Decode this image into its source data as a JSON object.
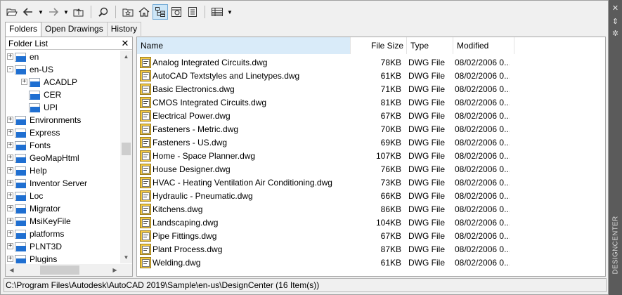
{
  "toolbar": {
    "buttons": [
      {
        "icon": "open-folder-icon",
        "active": false
      },
      {
        "icon": "back-arrow-icon",
        "active": false,
        "dropdown": true
      },
      {
        "icon": "forward-arrow-icon",
        "active": false,
        "dropdown": true
      },
      {
        "icon": "up-folder-icon",
        "active": false
      },
      {
        "icon": "search-icon",
        "active": false
      },
      {
        "icon": "favorites-icon",
        "active": false
      },
      {
        "icon": "home-icon",
        "active": false
      },
      {
        "icon": "tree-view-toggle-icon",
        "active": true
      },
      {
        "icon": "preview-icon",
        "active": false
      },
      {
        "icon": "description-icon",
        "active": false
      },
      {
        "icon": "views-icon",
        "active": false,
        "dropdown": true
      }
    ]
  },
  "tabs": [
    {
      "label": "Folders",
      "active": true
    },
    {
      "label": "Open Drawings",
      "active": false
    },
    {
      "label": "History",
      "active": false
    }
  ],
  "folder_list": {
    "header": "Folder List",
    "close_glyph": "✕",
    "items": [
      {
        "label": "en",
        "depth": 0,
        "expander": "+"
      },
      {
        "label": "en-US",
        "depth": 0,
        "expander": "−"
      },
      {
        "label": "ACADLP",
        "depth": 1,
        "expander": "+"
      },
      {
        "label": "CER",
        "depth": 1,
        "expander": ""
      },
      {
        "label": "UPI",
        "depth": 1,
        "expander": ""
      },
      {
        "label": "Environments",
        "depth": 0,
        "expander": "+"
      },
      {
        "label": "Express",
        "depth": 0,
        "expander": "+"
      },
      {
        "label": "Fonts",
        "depth": 0,
        "expander": "+"
      },
      {
        "label": "GeoMapHtml",
        "depth": 0,
        "expander": "+"
      },
      {
        "label": "Help",
        "depth": 0,
        "expander": "+"
      },
      {
        "label": "Inventor Server",
        "depth": 0,
        "expander": "+"
      },
      {
        "label": "Loc",
        "depth": 0,
        "expander": "+"
      },
      {
        "label": "Migrator",
        "depth": 0,
        "expander": "+"
      },
      {
        "label": "MsiKeyFile",
        "depth": 0,
        "expander": "+"
      },
      {
        "label": "platforms",
        "depth": 0,
        "expander": "+"
      },
      {
        "label": "PLNT3D",
        "depth": 0,
        "expander": "+"
      },
      {
        "label": "Plugins",
        "depth": 0,
        "expander": "+"
      }
    ]
  },
  "file_list": {
    "columns": {
      "name": "Name",
      "size": "File Size",
      "type": "Type",
      "modified": "Modified"
    },
    "rows": [
      {
        "name": "Analog Integrated Circuits.dwg",
        "size": "78KB",
        "type": "DWG File",
        "modified": "08/02/2006 0..."
      },
      {
        "name": "AutoCAD Textstyles and Linetypes.dwg",
        "size": "61KB",
        "type": "DWG File",
        "modified": "08/02/2006 0..."
      },
      {
        "name": "Basic Electronics.dwg",
        "size": "71KB",
        "type": "DWG File",
        "modified": "08/02/2006 0..."
      },
      {
        "name": "CMOS Integrated Circuits.dwg",
        "size": "81KB",
        "type": "DWG File",
        "modified": "08/02/2006 0..."
      },
      {
        "name": "Electrical Power.dwg",
        "size": "67KB",
        "type": "DWG File",
        "modified": "08/02/2006 0..."
      },
      {
        "name": "Fasteners - Metric.dwg",
        "size": "70KB",
        "type": "DWG File",
        "modified": "08/02/2006 0..."
      },
      {
        "name": "Fasteners - US.dwg",
        "size": "69KB",
        "type": "DWG File",
        "modified": "08/02/2006 0..."
      },
      {
        "name": "Home - Space Planner.dwg",
        "size": "107KB",
        "type": "DWG File",
        "modified": "08/02/2006 0..."
      },
      {
        "name": "House Designer.dwg",
        "size": "76KB",
        "type": "DWG File",
        "modified": "08/02/2006 0..."
      },
      {
        "name": "HVAC - Heating Ventilation Air Conditioning.dwg",
        "size": "73KB",
        "type": "DWG File",
        "modified": "08/02/2006 0..."
      },
      {
        "name": "Hydraulic - Pneumatic.dwg",
        "size": "66KB",
        "type": "DWG File",
        "modified": "08/02/2006 0..."
      },
      {
        "name": "Kitchens.dwg",
        "size": "86KB",
        "type": "DWG File",
        "modified": "08/02/2006 0..."
      },
      {
        "name": "Landscaping.dwg",
        "size": "104KB",
        "type": "DWG File",
        "modified": "08/02/2006 0..."
      },
      {
        "name": "Pipe Fittings.dwg",
        "size": "67KB",
        "type": "DWG File",
        "modified": "08/02/2006 0..."
      },
      {
        "name": "Plant Process.dwg",
        "size": "87KB",
        "type": "DWG File",
        "modified": "08/02/2006 0..."
      },
      {
        "name": "Welding.dwg",
        "size": "61KB",
        "type": "DWG File",
        "modified": "08/02/2006 0..."
      }
    ]
  },
  "status_bar": "C:\\Program Files\\Autodesk\\AutoCAD 2019\\Sample\\en-us\\DesignCenter (16 Item(s))",
  "side_panel": {
    "title": "DESIGNCENTER",
    "close_glyph": "✕",
    "autohide_glyph": "⇕",
    "properties_glyph": "✲"
  },
  "colors": {
    "folder_blue": "#1f6fd1",
    "sorted_header": "#d9ebf9",
    "side_panel": "#5b5b5b"
  }
}
